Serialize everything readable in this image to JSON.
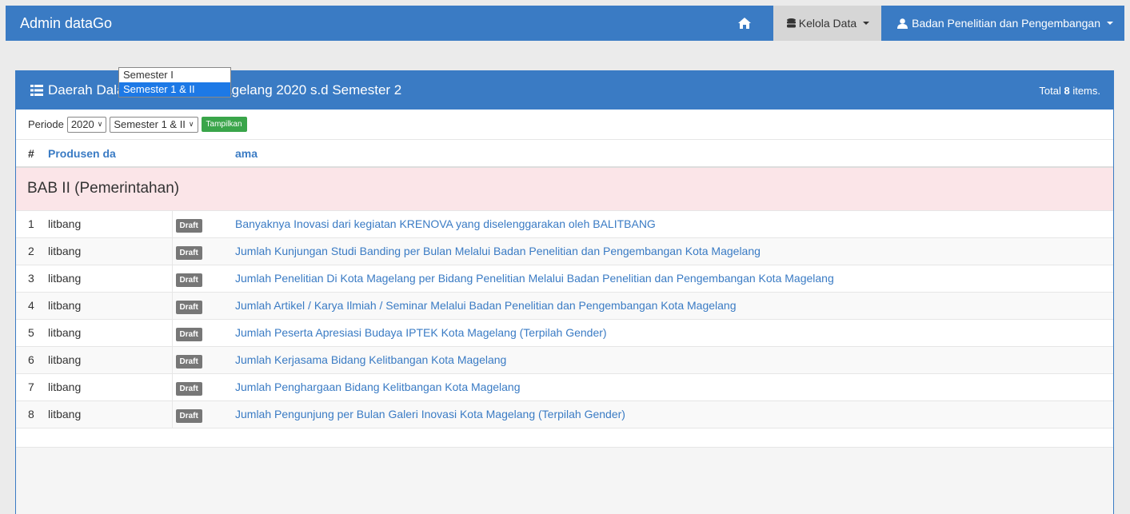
{
  "navbar": {
    "brand": "Admin dataGo",
    "home_icon": "home-icon",
    "kelola_label": "Kelola Data",
    "user_label": "Badan Penelitian dan Pengembangan"
  },
  "panel": {
    "title": "Daerah Dalam Angka Kota Magelang 2020 s.d Semester 2",
    "total_prefix": "Total",
    "total_count": "8",
    "total_suffix": "items."
  },
  "filter": {
    "periode_label": "Periode",
    "year_value": "2020",
    "semester_value": "Semester 1 & II",
    "button_label": "Tampilkan",
    "options": [
      "Semester I",
      "Semester 1 & II"
    ]
  },
  "table": {
    "headers": [
      "#",
      "Produsen da",
      "ama"
    ],
    "section": "BAB II (Pemerintahan)",
    "rows": [
      {
        "no": "1",
        "produsen": "litbang",
        "status": "Draft",
        "title": "Banyaknya Inovasi dari kegiatan KRENOVA yang diselenggarakan oleh BALITBANG"
      },
      {
        "no": "2",
        "produsen": "litbang",
        "status": "Draft",
        "title": "Jumlah Kunjungan Studi Banding per Bulan Melalui Badan Penelitian dan Pengembangan Kota Magelang"
      },
      {
        "no": "3",
        "produsen": "litbang",
        "status": "Draft",
        "title": "Jumlah Penelitian Di Kota Magelang per Bidang Penelitian Melalui Badan Penelitian dan Pengembangan Kota Magelang"
      },
      {
        "no": "4",
        "produsen": "litbang",
        "status": "Draft",
        "title": "Jumlah Artikel / Karya Ilmiah / Seminar Melalui Badan Penelitian dan Pengembangan Kota Magelang"
      },
      {
        "no": "5",
        "produsen": "litbang",
        "status": "Draft",
        "title": "Jumlah Peserta Apresiasi Budaya IPTEK Kota Magelang (Terpilah Gender)"
      },
      {
        "no": "6",
        "produsen": "litbang",
        "status": "Draft",
        "title": "Jumlah Kerjasama Bidang Kelitbangan Kota Magelang"
      },
      {
        "no": "7",
        "produsen": "litbang",
        "status": "Draft",
        "title": "Jumlah Penghargaan Bidang Kelitbangan Kota Magelang"
      },
      {
        "no": "8",
        "produsen": "litbang",
        "status": "Draft",
        "title": "Jumlah Pengunjung per Bulan Galeri Inovasi Kota Magelang (Terpilah Gender)"
      }
    ]
  }
}
